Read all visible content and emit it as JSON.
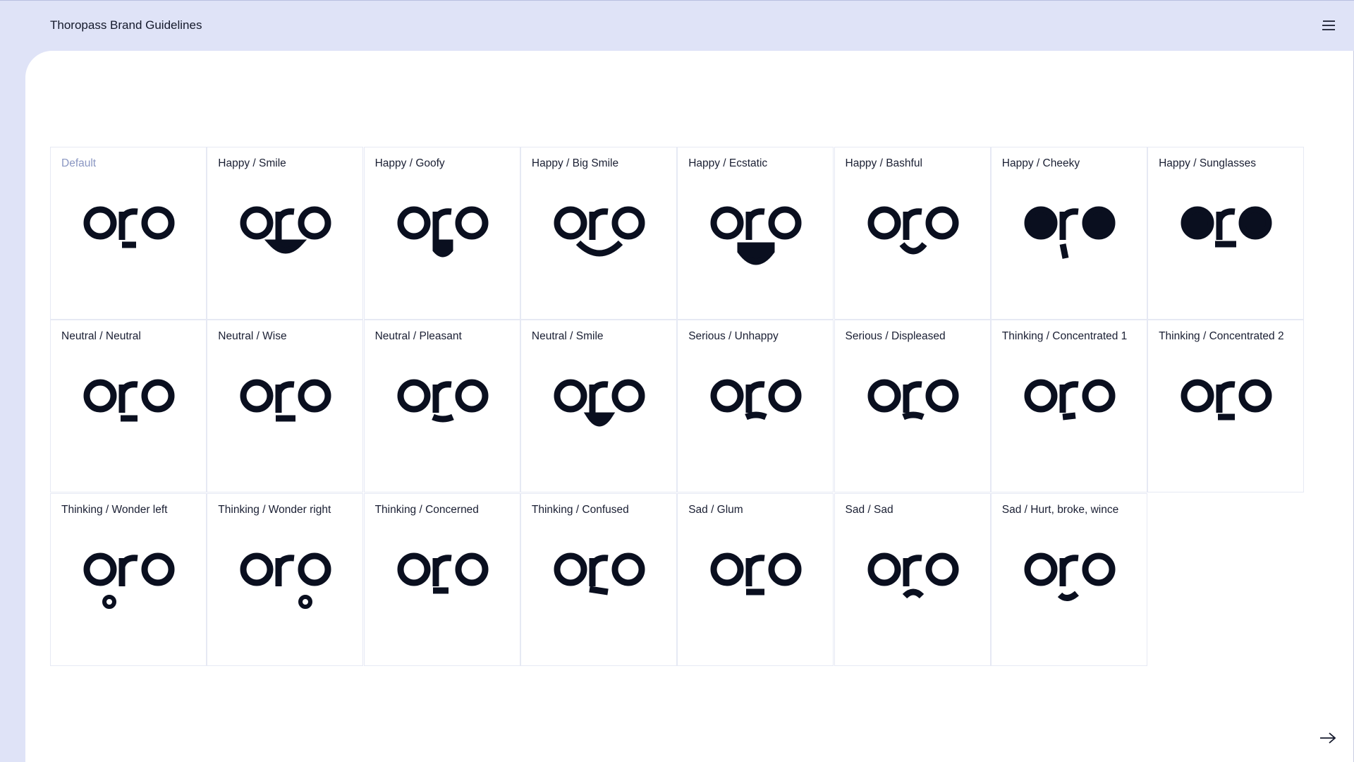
{
  "header": {
    "title": "Thoropass Brand Guidelines"
  },
  "icons": {
    "menu": "hamburger-menu-icon",
    "next": "arrow-right-icon"
  },
  "colors": {
    "accent": "#dfe3f7",
    "ink": "#0a0f1f",
    "muted": "#8a96c2"
  },
  "expressions": [
    {
      "label": "Default",
      "wordmark": "oro"
    },
    {
      "label": "Happy / Smile",
      "wordmark": "oro"
    },
    {
      "label": "Happy / Goofy",
      "wordmark": "oro"
    },
    {
      "label": "Happy / Big Smile",
      "wordmark": "oro"
    },
    {
      "label": "Happy / Ecstatic",
      "wordmark": "oro"
    },
    {
      "label": "Happy / Bashful",
      "wordmark": "oro"
    },
    {
      "label": "Happy / Cheeky",
      "wordmark": "oro"
    },
    {
      "label": "Happy / Sunglasses",
      "wordmark": "oro"
    },
    {
      "label": "Neutral / Neutral",
      "wordmark": "oro"
    },
    {
      "label": "Neutral / Wise",
      "wordmark": "oro"
    },
    {
      "label": "Neutral / Pleasant",
      "wordmark": "oro"
    },
    {
      "label": "Neutral / Smile",
      "wordmark": "oro"
    },
    {
      "label": "Serious / Unhappy",
      "wordmark": "oro"
    },
    {
      "label": "Serious / Displeased",
      "wordmark": "oro"
    },
    {
      "label": "Thinking / Concentrated 1",
      "wordmark": "oro"
    },
    {
      "label": "Thinking / Concentrated 2",
      "wordmark": "oro"
    },
    {
      "label": "Thinking / Wonder left",
      "wordmark": "oro"
    },
    {
      "label": "Thinking / Wonder right",
      "wordmark": "oro"
    },
    {
      "label": "Thinking / Concerned",
      "wordmark": "oro"
    },
    {
      "label": "Thinking / Confused",
      "wordmark": "oro"
    },
    {
      "label": "Sad / Glum",
      "wordmark": "oro"
    },
    {
      "label": "Sad / Sad",
      "wordmark": "oro"
    },
    {
      "label": "Sad / Hurt, broke, wince",
      "wordmark": "oro"
    }
  ]
}
